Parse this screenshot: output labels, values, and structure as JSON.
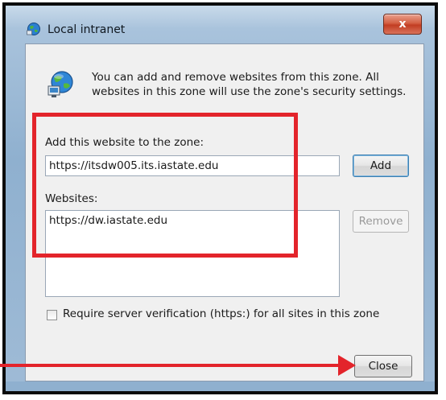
{
  "window": {
    "title": "Local intranet",
    "close_label": "x"
  },
  "dialog": {
    "info_text": "You can add and remove websites from this zone. All websites in this zone will use the zone's security settings.",
    "add_label": "Add this website to the zone:",
    "add_input_value": "https://itsdw005.its.iastate.edu",
    "add_button_label": "Add",
    "websites_label": "Websites:",
    "websites": [
      "https://dw.iastate.edu"
    ],
    "remove_button_label": "Remove",
    "require_https_label": "Require server verification (https:) for all sites in this zone",
    "require_https_checked": false,
    "close_button_label": "Close"
  },
  "icons": {
    "title": "globe-network-icon",
    "info": "globe-network-icon"
  },
  "annotations": {
    "highlight_color": "#e3242b",
    "arrow_target": "close-button"
  }
}
